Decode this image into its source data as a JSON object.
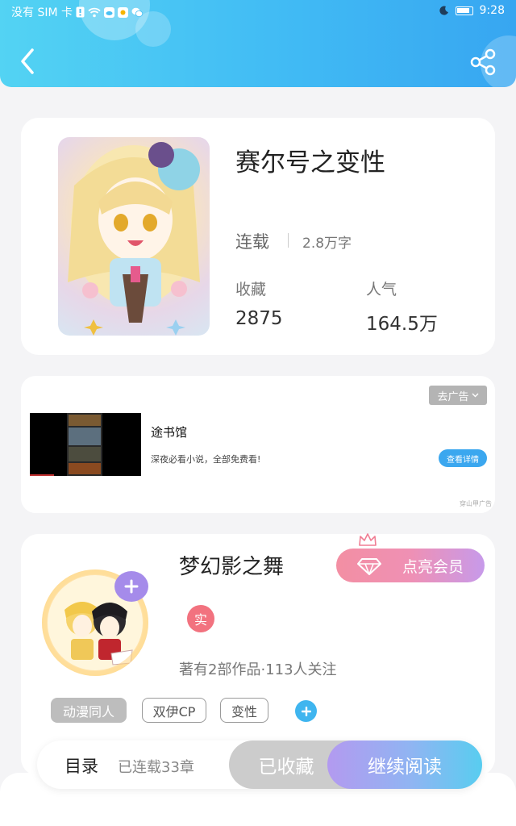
{
  "status_bar": {
    "carrier": "没有 SIM 卡",
    "time": "9:28"
  },
  "book": {
    "title": "赛尔号之变性",
    "status": "连载",
    "words": "2.8万字",
    "favorites_label": "收藏",
    "favorites_value": "2875",
    "popularity_label": "人气",
    "popularity_value": "164.5万"
  },
  "ad": {
    "close_label": "去广告",
    "title": "途书馆",
    "description": "深夜必看小说，全部免费看!",
    "button": "查看详情",
    "source": "穿山甲广告"
  },
  "author": {
    "name": "梦幻影之舞",
    "badge": "实",
    "vip_button": "点亮会员",
    "stats": "著有2部作品·113人关注",
    "tags": [
      "动漫同人",
      "双伊CP",
      "变性"
    ]
  },
  "bottom": {
    "toc": "目录",
    "chapters": "已连载33章",
    "collected": "已收藏",
    "continue": "继续阅读"
  },
  "colors": {
    "header_start": "#53d3f3",
    "header_end": "#37a6f1",
    "vip_gradient": [
      "#f38fa3",
      "#c79aea"
    ],
    "read_gradient": [
      "#b39af0",
      "#58cdf0"
    ]
  }
}
